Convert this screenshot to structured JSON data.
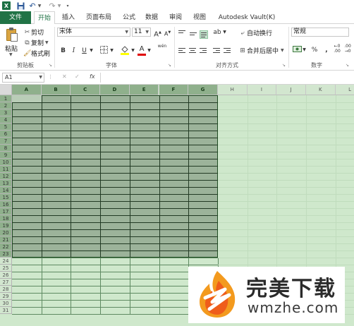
{
  "quick_access": {
    "app_icon": "X",
    "save_icon": "save-icon",
    "undo_icon": "undo-icon",
    "redo_icon": "redo-icon"
  },
  "tabs": [
    "文件",
    "开始",
    "插入",
    "页面布局",
    "公式",
    "数据",
    "审阅",
    "视图",
    "Autodesk Vault(K)"
  ],
  "ribbon": {
    "clipboard": {
      "paste": "粘贴",
      "cut": "剪切",
      "copy": "复制",
      "format_painter": "格式刷",
      "group_label": "剪贴板"
    },
    "font": {
      "font_name": "宋体",
      "font_size": "11",
      "bold": "B",
      "italic": "I",
      "underline": "U",
      "grow": "A",
      "shrink": "A",
      "font_color": "A",
      "wen": "wén",
      "group_label": "字体"
    },
    "alignment": {
      "wrap_text": "自动换行",
      "merge_center": "合并后居中",
      "group_label": "对齐方式"
    },
    "number": {
      "format": "常规",
      "percent": "%",
      "comma": ",",
      "group_label": "数字"
    }
  },
  "formula_bar": {
    "name_box": "A1",
    "fx": "fx",
    "cancel": "✕",
    "enter": "✓",
    "value": ""
  },
  "grid": {
    "columns": [
      "A",
      "B",
      "C",
      "D",
      "E",
      "F",
      "G",
      "H",
      "I",
      "J",
      "K",
      "L"
    ],
    "selected_columns": [
      "A",
      "B",
      "C",
      "D",
      "E",
      "F",
      "G"
    ],
    "rows": [
      "1",
      "2",
      "3",
      "4",
      "5",
      "6",
      "7",
      "8",
      "9",
      "10",
      "11",
      "12",
      "13",
      "14",
      "15",
      "16",
      "17",
      "18",
      "19",
      "20",
      "21",
      "22",
      "23",
      "24",
      "25",
      "26",
      "27",
      "28",
      "29",
      "30",
      "31"
    ],
    "selected_rows_last": "23"
  },
  "colors": {
    "excel_green": "#217346",
    "selection_fill": "#9cb39a",
    "sheet_tint": "#cfe8cc"
  },
  "watermark": {
    "title": "完美下载",
    "url": "wmzhe.com"
  }
}
